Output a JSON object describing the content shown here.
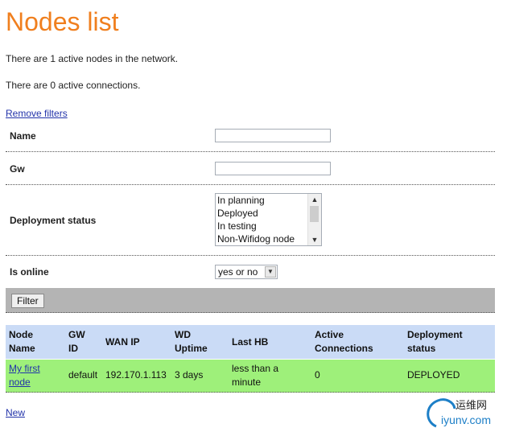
{
  "page": {
    "title": "Nodes list",
    "active_nodes_text": "There are 1 active nodes in the network.",
    "active_connections_text": "There are 0 active connections.",
    "remove_filters_label": "Remove filters",
    "new_label": "New"
  },
  "filters": {
    "name": {
      "label": "Name",
      "value": ""
    },
    "gw": {
      "label": "Gw",
      "value": ""
    },
    "deployment_status": {
      "label": "Deployment status",
      "options": [
        "In planning",
        "Deployed",
        "In testing",
        "Non-Wifidog node"
      ]
    },
    "is_online": {
      "label": "Is online",
      "selected": "yes or no"
    },
    "filter_button": "Filter"
  },
  "table": {
    "headers": {
      "node_name": [
        "Node",
        "Name"
      ],
      "gw_id": [
        "GW",
        "ID"
      ],
      "wan_ip": "WAN IP",
      "wd_uptime": [
        "WD",
        "Uptime"
      ],
      "last_hb": "Last HB",
      "active_connections": [
        "Active",
        "Connections"
      ],
      "deployment_status": [
        "Deployment",
        "status"
      ]
    },
    "rows": [
      {
        "node_name": [
          "My first",
          "node"
        ],
        "gw_id": "default",
        "wan_ip": "192.170.1.113",
        "wd_uptime": "3 days",
        "last_hb": [
          "less than a",
          "minute"
        ],
        "active_connections": "0",
        "deployment_status": "DEPLOYED"
      }
    ]
  },
  "watermark": {
    "cn": "运维网",
    "url": "iyunv.com"
  },
  "colors": {
    "title": "#f07f1e",
    "link": "#2233aa",
    "filter_bar": "#b4b4b4",
    "table_header": "#cadbf6",
    "table_row": "#9ef07a",
    "watermark": "#1d7fc7"
  },
  "icons": {
    "listbox_up": "chevron-up-icon",
    "listbox_down": "chevron-down-icon",
    "select_arrow": "chevron-down-icon",
    "watermark_logo": "swirl-logo-icon"
  }
}
